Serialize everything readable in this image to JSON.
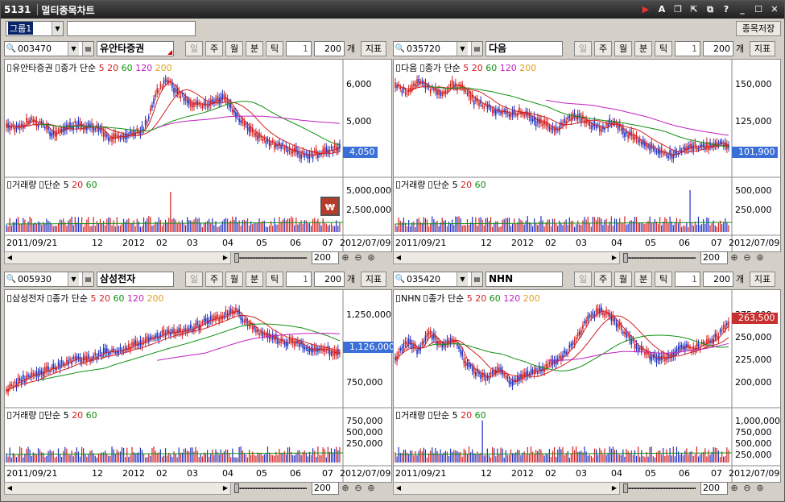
{
  "window": {
    "screen_no": "5131",
    "title": "멀티종목차트",
    "ctrl_icons": [
      "record-icon",
      "font-icon",
      "copy-window-icon",
      "expand-icon",
      "restore-icon",
      "help-icon",
      "minimize-icon",
      "maximize-icon",
      "close-icon"
    ]
  },
  "toolbar": {
    "group_select": "그룹1",
    "group_name": "",
    "save_button": "종목저장"
  },
  "panels": [
    {
      "code": "003470",
      "name": "유안타증권",
      "flag": true,
      "period_buttons": [
        "일",
        "주",
        "월",
        "분",
        "틱"
      ],
      "count1": "1",
      "count2": "200",
      "unit": "개",
      "indicator_button": "지표",
      "legend_price": [
        "유안타증권",
        "종가 단순",
        "5",
        "20",
        "60",
        "120",
        "200"
      ],
      "legend_volume": [
        "거래량",
        "단순",
        "5",
        "20",
        "60"
      ],
      "price_axis": [
        "6,000",
        "5,000"
      ],
      "price_tag": "4,050",
      "volume_axis": [
        "5,000,000",
        "2,500,000"
      ],
      "dates": [
        "2011/09/21",
        "12",
        "2012",
        "02",
        "03",
        "04",
        "05",
        "06",
        "07"
      ],
      "date_end": "2012/07/09",
      "zoom": "200",
      "badge": "₩"
    },
    {
      "code": "035720",
      "name": "다음",
      "flag": false,
      "period_buttons": [
        "일",
        "주",
        "월",
        "분",
        "틱"
      ],
      "count1": "1",
      "count2": "200",
      "unit": "개",
      "indicator_button": "지표",
      "legend_price": [
        "다음",
        "종가 단순",
        "5",
        "20",
        "60",
        "120",
        "200"
      ],
      "legend_volume": [
        "거래량",
        "단순",
        "5",
        "20",
        "60"
      ],
      "price_axis": [
        "150,000",
        "125,000"
      ],
      "price_tag": "101,900",
      "volume_axis": [
        "500,000",
        "250,000"
      ],
      "dates": [
        "2011/09/21",
        "12",
        "2012",
        "02",
        "03",
        "04",
        "05",
        "06",
        "07"
      ],
      "date_end": "2012/07/09",
      "zoom": "200"
    },
    {
      "code": "005930",
      "name": "삼성전자",
      "flag": false,
      "period_buttons": [
        "일",
        "주",
        "월",
        "분",
        "틱"
      ],
      "count1": "1",
      "count2": "200",
      "unit": "개",
      "indicator_button": "지표",
      "legend_price": [
        "삼성전자",
        "종가 단순",
        "5",
        "20",
        "60",
        "120",
        "200"
      ],
      "legend_volume": [
        "거래량",
        "단순",
        "5",
        "20",
        "60"
      ],
      "price_axis": [
        "1,250,000",
        "1,000,000",
        "750,000"
      ],
      "price_tag": "1,126,000",
      "volume_axis": [
        "750,000",
        "500,000",
        "250,000"
      ],
      "dates": [
        "2011/09/21",
        "12",
        "2012",
        "02",
        "03",
        "04",
        "05",
        "06",
        "07"
      ],
      "date_end": "2012/07/09",
      "zoom": "200"
    },
    {
      "code": "035420",
      "name": "NHN",
      "flag": false,
      "period_buttons": [
        "일",
        "주",
        "월",
        "분",
        "틱"
      ],
      "count1": "1",
      "count2": "200",
      "unit": "개",
      "indicator_button": "지표",
      "legend_price": [
        "NHN",
        "종가 단순",
        "5",
        "20",
        "60",
        "120",
        "200"
      ],
      "legend_volume": [
        "거래량",
        "단순",
        "5",
        "20",
        "60"
      ],
      "price_axis": [
        "275,000",
        "250,000",
        "225,000",
        "200,000"
      ],
      "price_tag": "263,500",
      "volume_axis": [
        "1,000,000",
        "750,000",
        "500,000",
        "250,000"
      ],
      "dates": [
        "2011/09/21",
        "12",
        "2012",
        "02",
        "03",
        "04",
        "05",
        "06",
        "07"
      ],
      "date_end": "2012/07/09",
      "zoom": "200"
    }
  ],
  "colors": {
    "up": "#d42020",
    "down": "#2030c0",
    "ma5": "#d42020",
    "ma20": "#d42020",
    "ma60": "#109010",
    "ma120": "#c020c0",
    "ma200": "#e0a020",
    "tag_blue": "#3a6fd8",
    "tag_red": "#c83030"
  }
}
